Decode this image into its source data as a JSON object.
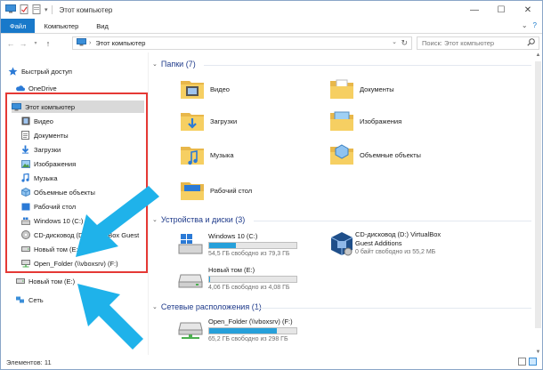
{
  "window": {
    "title": "Этот компьютер",
    "controls": {
      "minimize": "—",
      "maximize": "☐",
      "close": "✕"
    }
  },
  "ribbon": {
    "tabs": [
      "Файл",
      "Компьютер",
      "Вид"
    ],
    "help": "?"
  },
  "address": {
    "path": "Этот компьютер",
    "search_placeholder": "Поиск: Этот компьютер"
  },
  "nav": {
    "quick_access": "Быстрый доступ",
    "onedrive": "OneDrive",
    "this_pc": "Этот компьютер",
    "items": [
      "Видео",
      "Документы",
      "Загрузки",
      "Изображения",
      "Музыка",
      "Объемные объекты",
      "Рабочий стол",
      "Windows 10 (C:)",
      "CD-дисковод (D:) VirtualBox Guest",
      "Новый том (E:)",
      "Open_Folder (\\\\vboxsrv) (F:)"
    ],
    "new_volume": "Новый том (E:)",
    "network": "Сеть"
  },
  "main": {
    "folders_header": "Папки (7)",
    "folders": [
      "Видео",
      "Документы",
      "Загрузки",
      "Изображения",
      "Музыка",
      "Объемные объекты",
      "Рабочий стол"
    ],
    "devices_header": "Устройства и диски (3)",
    "drives": [
      {
        "name": "Windows 10 (C:)",
        "free": "54,5 ГБ свободно из 79,3 ГБ",
        "used_fraction": 0.31
      },
      {
        "name": "CD-дисковод (D:) VirtualBox",
        "name2": "Guest Additions",
        "free": "0 байт свободно из 55,2 МБ"
      },
      {
        "name": "Новый том (E:)",
        "free": "4,06 ГБ свободно из 4,08 ГБ",
        "used_fraction": 0.01
      }
    ],
    "network_header": "Сетевые расположения (1)",
    "network_drive": {
      "name": "Open_Folder (\\\\vboxsrv) (F:)",
      "free": "65,2 ГБ свободно из 298 ГБ",
      "used_fraction": 0.78
    }
  },
  "status": {
    "items": "Элементов: 11"
  },
  "colors": {
    "accent": "#1979ca",
    "highlight_box": "#e53935",
    "callout_arrow": "#1fb2ea",
    "bar_fill": "#26a0da"
  }
}
